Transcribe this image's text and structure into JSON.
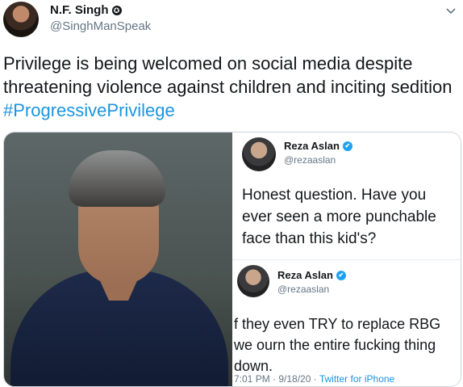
{
  "author": {
    "name": "N.F. Singh",
    "handle": "@SinghManSpeak"
  },
  "tweet": {
    "text": "Privilege is being welcomed on social media despite threatening violence against children and inciting sedition ",
    "hashtag": "#ProgressivePrivilege"
  },
  "embedded": {
    "tweet1": {
      "name": "Reza Aslan",
      "handle": "@rezaaslan",
      "text": "Honest question. Have you ever seen a more punchable face than this kid's?"
    },
    "tweet2": {
      "name": "Reza Aslan",
      "handle": "@rezaaslan",
      "text": "f they even TRY to replace RBG we ourn the entire fucking thing down.",
      "time": "7:01 PM · 9/18/20 · ",
      "source": "Twitter for iPhone"
    }
  },
  "icons": {
    "caret": "chevron-down-icon",
    "badge": "badge-icon",
    "verified": "verified-icon"
  },
  "colors": {
    "link": "#1b95e0",
    "muted": "#657786",
    "verified": "#1da1f2"
  }
}
